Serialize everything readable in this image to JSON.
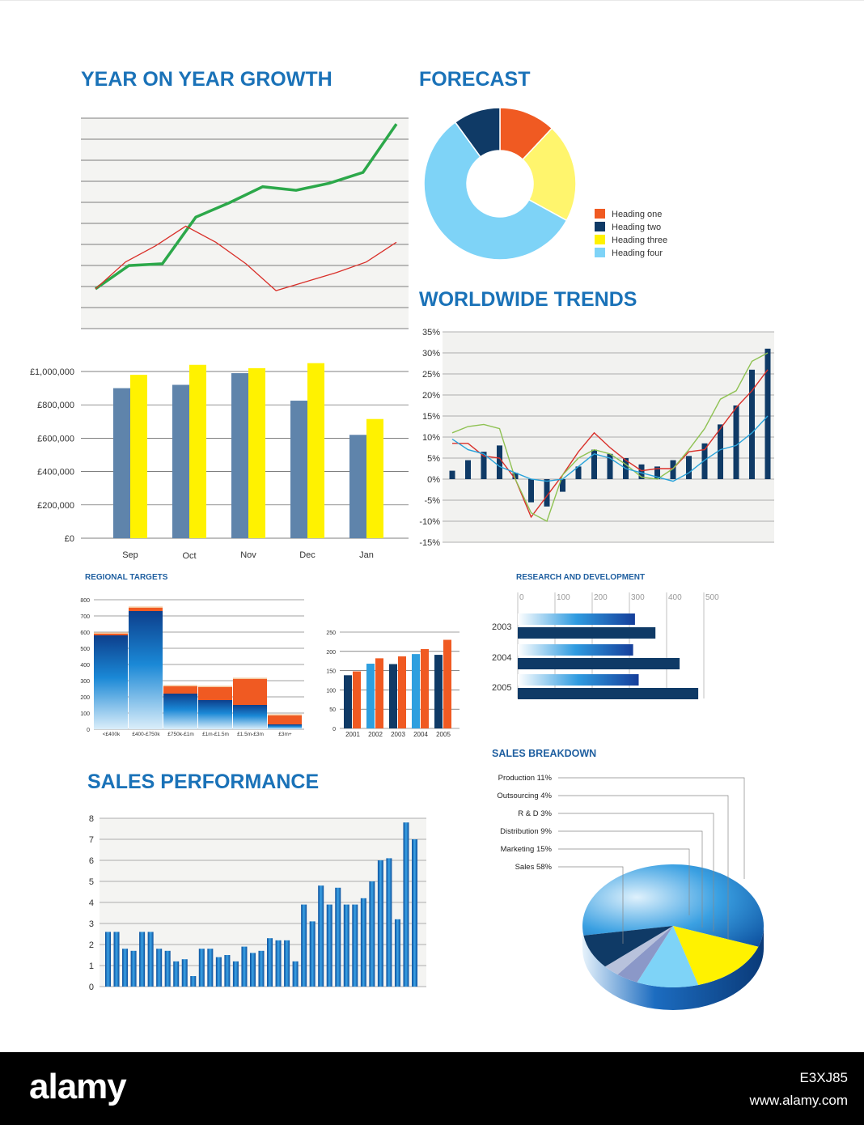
{
  "titles": {
    "growth": "YEAR ON YEAR GROWTH",
    "forecast": "FORECAST",
    "trends": "WORLDWIDE TRENDS",
    "regional": "REGIONAL TARGETS",
    "rnd": "RESEARCH AND DEVELOPMENT",
    "sales_perf": "SALES PERFORMANCE",
    "breakdown": "SALES BREAKDOWN"
  },
  "footer": {
    "watermark": "alamy",
    "image_id": "E3XJ85",
    "site": "www.alamy.com"
  },
  "colors": {
    "title": "#1a72b8",
    "green": "#2ca84a",
    "red": "#d9302a",
    "steel": "#5f84ab",
    "yellow": "#fff200",
    "navy": "#0f3a66",
    "orange": "#f05a22",
    "sky": "#7ed3f7"
  },
  "chart_data": [
    {
      "id": "growth",
      "type": "line",
      "title": "YEAR ON YEAR GROWTH",
      "ylim": [
        0,
        10
      ],
      "gridlines": 11,
      "series": [
        {
          "values": [
            1.0,
            2.3,
            2.4,
            5.0,
            5.8,
            6.7,
            6.5,
            6.9,
            7.5,
            10.2
          ]
        },
        {
          "values": [
            1.0,
            2.5,
            3.4,
            4.5,
            3.6,
            2.4,
            0.9,
            1.4,
            1.9,
            2.5,
            3.6
          ]
        }
      ]
    },
    {
      "id": "forecast",
      "type": "pie",
      "title": "FORECAST",
      "donut": true,
      "slices": [
        {
          "label": "Heading one",
          "value": 12,
          "color": "#f05a22"
        },
        {
          "label": "Heading three",
          "value": 21,
          "color": "#fff56d"
        },
        {
          "label": "Heading four",
          "value": 57,
          "color": "#7ed3f7"
        },
        {
          "label": "Heading two",
          "value": 10,
          "color": "#0f3a66"
        }
      ],
      "legend": [
        "Heading one",
        "Heading two",
        "Heading three",
        "Heading four"
      ],
      "legend_colors": [
        "#f05a22",
        "#0f3a66",
        "#fff200",
        "#7ed3f7"
      ]
    },
    {
      "id": "monthly",
      "type": "bar",
      "categories": [
        "Sep",
        "Oct",
        "Nov",
        "Dec",
        "Jan"
      ],
      "ylim": [
        0,
        1000000
      ],
      "yticks": [
        "£0",
        "£200,000",
        "£400,000",
        "£600,000",
        "£800,000",
        "£1,000,000"
      ],
      "series": [
        {
          "values": [
            900000,
            920000,
            990000,
            825000,
            620000
          ],
          "color": "#5f84ab"
        },
        {
          "values": [
            980000,
            1040000,
            1020000,
            1050000,
            715000
          ],
          "color": "#fff200"
        }
      ]
    },
    {
      "id": "trends",
      "type": "bar",
      "title": "WORLDWIDE TRENDS",
      "ylim": [
        -15,
        35
      ],
      "yticks": [
        "35%",
        "30%",
        "25%",
        "20%",
        "15%",
        "10%",
        "5%",
        "0%",
        "-5%",
        "-10%",
        "-15%"
      ],
      "bars": [
        2,
        4.5,
        6.5,
        8,
        1.5,
        -5.5,
        -6.5,
        -3,
        3,
        7,
        6,
        5,
        3.5,
        3,
        4.5,
        5.5,
        8.5,
        13,
        17.5,
        26,
        31
      ],
      "lines": [
        {
          "color": "#d9302a",
          "values": [
            8.5,
            8.5,
            5.5,
            5,
            0,
            -9,
            -4,
            1,
            6.5,
            11,
            7.5,
            4.5,
            2,
            2.5,
            2.5,
            6.5,
            7,
            12,
            17,
            21,
            26
          ]
        },
        {
          "color": "#8fc253",
          "values": [
            11,
            12.5,
            13,
            12,
            0,
            -8,
            -10,
            1,
            5,
            7,
            6,
            3.5,
            0.5,
            0,
            2.5,
            7,
            12,
            19,
            21,
            28,
            30
          ]
        },
        {
          "color": "#29a3da",
          "values": [
            9.5,
            7,
            6,
            3,
            1.5,
            0,
            -0.5,
            0,
            3,
            6,
            5,
            2.5,
            1.5,
            0.5,
            -0.5,
            1.5,
            4.5,
            7,
            8,
            11,
            15
          ]
        }
      ]
    },
    {
      "id": "regional",
      "type": "bar",
      "title": "REGIONAL TARGETS",
      "categories": [
        "<£400k",
        "£400-£750k",
        "£750k-£1m",
        "£1m-£1.5m",
        "£1.5m-£3m",
        "£3m+"
      ],
      "ylim": [
        0,
        800
      ],
      "yticks": [
        "0",
        "100",
        "200",
        "300",
        "400",
        "500",
        "600",
        "700",
        "800"
      ],
      "stacks": [
        {
          "blue": 580,
          "orange": 10,
          "tan": 8
        },
        {
          "blue": 730,
          "orange": 20,
          "tan": 8
        },
        {
          "blue": 220,
          "orange": 45,
          "tan": 8
        },
        {
          "blue": 180,
          "orange": 80,
          "tan": 8
        },
        {
          "blue": 150,
          "orange": 160,
          "tan": 8
        },
        {
          "blue": 30,
          "orange": 55,
          "tan": 8
        }
      ]
    },
    {
      "id": "yearly",
      "type": "bar",
      "categories": [
        "2001",
        "2002",
        "2003",
        "2004",
        "2005"
      ],
      "ylim": [
        0,
        250
      ],
      "yticks": [
        "0",
        "50",
        "100",
        "150",
        "200",
        "250"
      ],
      "series": [
        {
          "values": [
            138,
            168,
            167,
            193,
            191
          ],
          "color": "#0f3a66"
        },
        {
          "values": [
            148,
            182,
            187,
            206,
            230
          ],
          "color": "#f05a22"
        }
      ],
      "extra_bar": {
        "values": [
          0,
          168,
          0,
          193,
          0
        ],
        "color": "#2e9fdf"
      }
    },
    {
      "id": "rnd",
      "type": "bar",
      "title": "RESEARCH AND DEVELOPMENT",
      "orientation": "horizontal",
      "categories": [
        "2003",
        "2004",
        "2005"
      ],
      "xlim": [
        0,
        500
      ],
      "xticks": [
        "0",
        "100",
        "200",
        "300",
        "400",
        "500"
      ],
      "series": [
        {
          "values": [
            315,
            310,
            325
          ],
          "style": "gradient"
        },
        {
          "values": [
            370,
            435,
            485
          ],
          "style": "navy"
        }
      ]
    },
    {
      "id": "sales_perf",
      "type": "bar",
      "title": "SALES PERFORMANCE",
      "ylim": [
        0,
        8
      ],
      "yticks": [
        "0",
        "1",
        "2",
        "3",
        "4",
        "5",
        "6",
        "7",
        "8"
      ],
      "values": [
        2.6,
        2.6,
        1.8,
        1.7,
        2.6,
        2.6,
        1.8,
        1.7,
        1.2,
        1.3,
        0.5,
        1.8,
        1.8,
        1.4,
        1.5,
        1.2,
        1.9,
        1.6,
        1.7,
        2.3,
        2.2,
        2.2,
        1.2,
        3.9,
        3.1,
        4.8,
        3.9,
        4.7,
        3.9,
        3.9,
        4.2,
        5.0,
        6.0,
        6.1,
        3.2,
        7.8,
        7.0
      ]
    },
    {
      "id": "breakdown",
      "type": "pie",
      "title": "SALES BREAKDOWN",
      "labels": [
        "Production 11%",
        "Outsourcing  4%",
        "R & D 3%",
        "Distribution  9%",
        "Marketing  15%",
        "Sales  58%"
      ],
      "slices": [
        {
          "name": "Sales",
          "value": 58,
          "color": "#2c8fd8"
        },
        {
          "name": "Marketing",
          "value": 15,
          "color": "#fff200"
        },
        {
          "name": "Production",
          "value": 11,
          "color": "#7ed3f7"
        },
        {
          "name": "Outsourcing",
          "value": 4,
          "color": "#8b98c8"
        },
        {
          "name": "R & D",
          "value": 3,
          "color": "#b8c2dc"
        },
        {
          "name": "Distribution",
          "value": 9,
          "color": "#0f3a66"
        }
      ]
    }
  ]
}
